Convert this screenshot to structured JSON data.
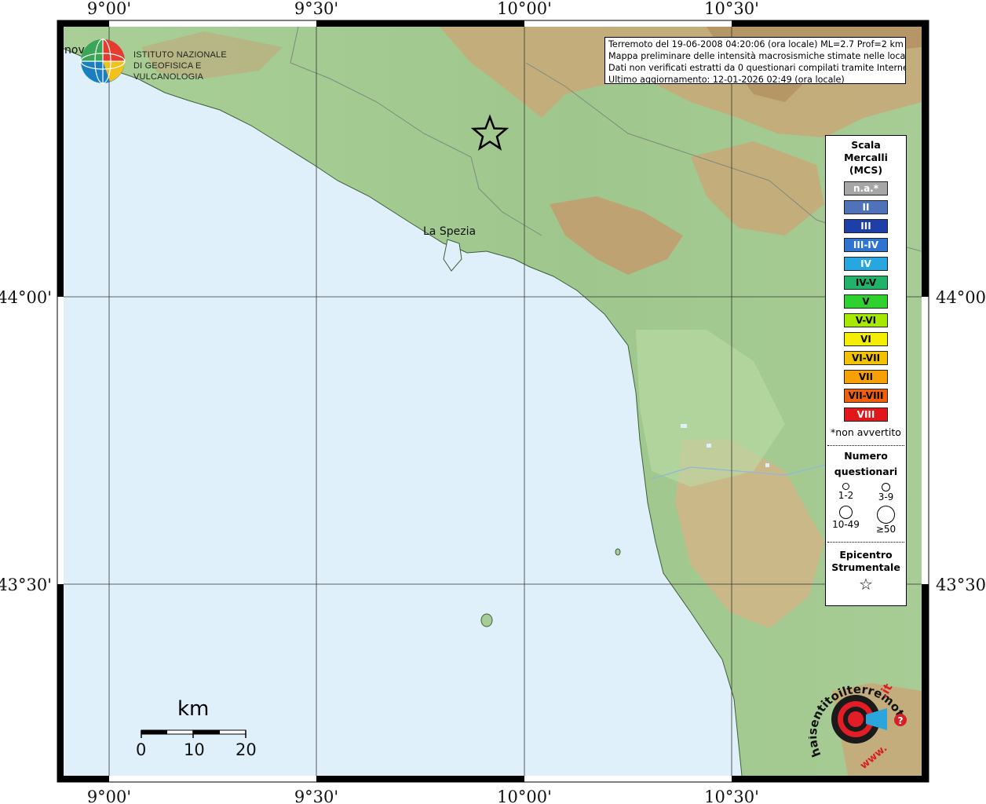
{
  "info": {
    "line1": "Terremoto del 19-06-2008 04:20:06 (ora locale) ML=2.7 Prof=2 km",
    "line2": "Mappa preliminare delle intensità macrosismiche stimate nelle località",
    "line3": "Dati non verificati estratti da 0 questionari compilati tramite Internet.",
    "line4": "Ultimo aggiornamento: 12-01-2026 02:49 (ora locale)"
  },
  "map": {
    "top_ticks": [
      "9°00'",
      "9°30'",
      "10°00'",
      "10°30'"
    ],
    "bottom_ticks": [
      "9°00'",
      "9°30'",
      "10°00'",
      "10°30'"
    ],
    "left_ticks": [
      "44°00'",
      "43°30'"
    ],
    "right_ticks": [
      "44°00'",
      "43°30'"
    ],
    "places": [
      {
        "name": "La Spezia"
      },
      {
        "name": "nova"
      }
    ]
  },
  "logo": {
    "line1": "ISTITUTO NAZIONALE",
    "line2": "DI GEOFISICA E VULCANOLOGIA"
  },
  "legend": {
    "title_line1": "Scala",
    "title_line2": "Mercalli",
    "title_line3": "(MCS)",
    "intensities": [
      {
        "label": "n.a.*",
        "color": "#a6a6a6",
        "text_color": "#ffffff"
      },
      {
        "label": "II",
        "color": "#4f72b8",
        "text_color": "#ffffff"
      },
      {
        "label": "III",
        "color": "#1e3ea8",
        "text_color": "#ffffff"
      },
      {
        "label": "III-IV",
        "color": "#2f74d0",
        "text_color": "#ffffff"
      },
      {
        "label": "IV",
        "color": "#27a6e0",
        "text_color": "#ffffff"
      },
      {
        "label": "IV-V",
        "color": "#21b36a",
        "text_color": "#000000"
      },
      {
        "label": "V",
        "color": "#2ed12e",
        "text_color": "#000000"
      },
      {
        "label": "V-VI",
        "color": "#a6e800",
        "text_color": "#000000"
      },
      {
        "label": "VI",
        "color": "#f4ef00",
        "text_color": "#000000"
      },
      {
        "label": "VI-VII",
        "color": "#f2c200",
        "text_color": "#000000"
      },
      {
        "label": "VII",
        "color": "#f7a000",
        "text_color": "#000000"
      },
      {
        "label": "VII-VIII",
        "color": "#f05f0a",
        "text_color": "#000000"
      },
      {
        "label": "VIII",
        "color": "#e0181c",
        "text_color": "#ffffff"
      }
    ],
    "note": "*non avvertito",
    "questionnaire_title1": "Numero",
    "questionnaire_title2": "questionari",
    "circles": [
      {
        "label": "1-2"
      },
      {
        "label": "3-9"
      },
      {
        "label": "10-49"
      },
      {
        "label": "≥50"
      }
    ],
    "epicenter_title1": "Epicentro",
    "epicenter_title2": "Strumentale",
    "epicenter_symbol": "☆"
  },
  "scale": {
    "unit": "km",
    "labels": [
      "0",
      "10",
      "20"
    ]
  },
  "hai_logo": {
    "text": "haisentitoilterremoto",
    "suffix": ".it",
    "prefix": "www.",
    "question": "?"
  },
  "colors": {
    "sea": "#dff0fb",
    "land": "#a7cc95",
    "mountains": "#c79a6d"
  }
}
